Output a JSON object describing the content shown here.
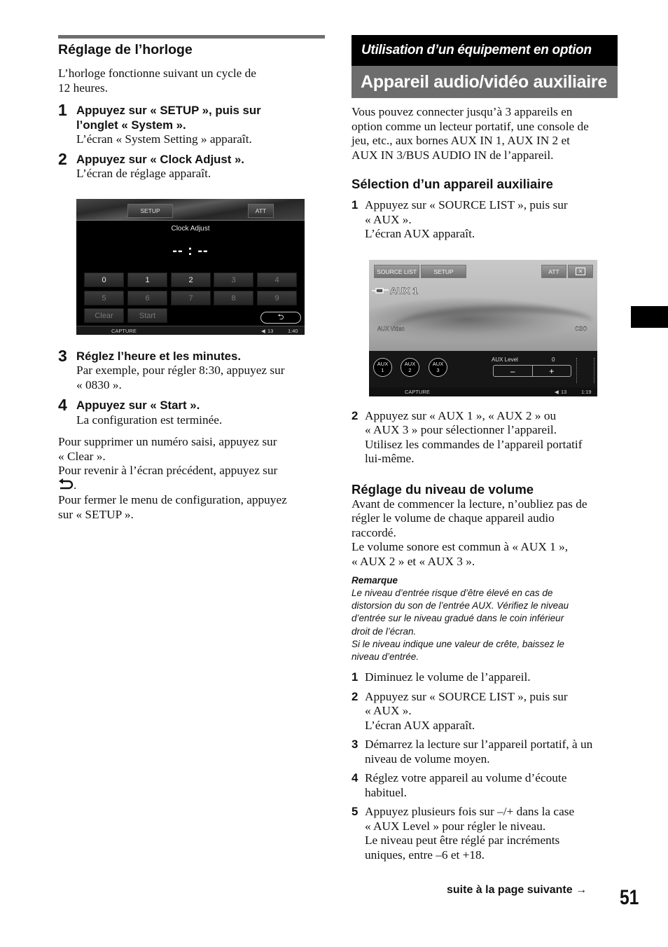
{
  "left": {
    "section_title": "Réglage de l’horloge",
    "intro": [
      "L’horloge fonctionne suivant un cycle de",
      "12 heures."
    ],
    "steps": [
      {
        "num": "1",
        "title": [
          "Appuyez sur « SETUP », puis sur",
          "l’onglet « System »."
        ],
        "body": [
          "L’écran « System Setting » apparaît."
        ]
      },
      {
        "num": "2",
        "title": [
          "Appuyez sur « Clock Adjust »."
        ],
        "body": [
          "L’écran de réglage apparaît."
        ]
      },
      {
        "num": "3",
        "title": [
          "Réglez l’heure et les minutes."
        ],
        "body": [
          "Par exemple, pour régler 8:30, appuyez sur",
          "« 0830 »."
        ]
      },
      {
        "num": "4",
        "title": [
          "Appuyez sur « Start »."
        ],
        "body": [
          "La configuration est terminée."
        ]
      }
    ],
    "tips": [
      "Pour supprimer un numéro saisi, appuyez sur",
      "« Clear ».",
      "Pour revenir à l’écran précédent, appuyez sur",
      ".",
      "Pour fermer le menu de configuration, appuyez",
      "sur « SETUP »."
    ],
    "back_icon": "return-arrow-icon"
  },
  "clock_screen": {
    "setup_btn": "SETUP",
    "att_btn": "ATT",
    "title": "Clock Adjust",
    "time_display": "-- : --",
    "keys": [
      "0",
      "1",
      "2",
      "3",
      "4",
      "5",
      "6",
      "7",
      "8",
      "9"
    ],
    "clear": "Clear",
    "start": "Start",
    "back_glyph": "⮌",
    "status_capture": "CAPTURE",
    "status_volume": "13",
    "status_time": "1:40"
  },
  "right": {
    "section_band": "Utilisation d’un équipement en option",
    "title_band": "Appareil audio/vidéo auxiliaire",
    "intro": [
      "Vous pouvez connecter jusqu’à 3 appareils en",
      "option comme un lecteur portatif, une console de",
      "jeu, etc., aux bornes AUX IN 1, AUX IN 2 et",
      "AUX IN 3/BUS AUDIO IN de l’appareil."
    ],
    "sub1_title": "Sélection d’un appareil auxiliaire",
    "sub1_steps": [
      {
        "num": "1",
        "lines": [
          "Appuyez sur « SOURCE LIST », puis sur",
          "« AUX ».",
          "L’écran AUX apparaît."
        ]
      },
      {
        "num": "2",
        "lines": [
          "Appuyez sur « AUX 1 », « AUX 2 » ou",
          "« AUX 3 » pour sélectionner l’appareil.",
          "Utilisez les commandes de l’appareil portatif",
          "lui-même."
        ]
      }
    ],
    "sub2_title": "Réglage du niveau de volume",
    "sub2_intro": [
      "Avant de commencer la lecture, n’oubliez pas de",
      "régler le volume de chaque appareil audio",
      "raccordé.",
      "Le volume sonore est commun à « AUX 1 »,",
      "« AUX 2 » et « AUX 3 »."
    ],
    "note_title": "Remarque",
    "note_lines": [
      "Le niveau d’entrée risque d’être élevé en cas de",
      "distorsion du son de l’entrée AUX. Vérifiez le niveau",
      "d’entrée sur le niveau gradué dans le coin inférieur",
      "droit de l’écran.",
      "Si le niveau indique une valeur de crête, baissez le",
      "niveau d’entrée."
    ],
    "sub2_steps": [
      {
        "num": "1",
        "lines": [
          "Diminuez le volume de l’appareil."
        ]
      },
      {
        "num": "2",
        "lines": [
          "Appuyez sur « SOURCE LIST », puis sur",
          "« AUX ».",
          "L’écran AUX apparaît."
        ]
      },
      {
        "num": "3",
        "lines": [
          "Démarrez la lecture sur l’appareil portatif, à un",
          "niveau de volume moyen."
        ]
      },
      {
        "num": "4",
        "lines": [
          "Réglez votre appareil au volume d’écoute",
          "habituel."
        ]
      },
      {
        "num": "5",
        "lines": [
          "Appuyez plusieurs fois sur –/+ dans la case",
          "« AUX Level » pour régler le niveau.",
          "Le niveau peut être réglé par incréments",
          "uniques, entre –6 et +18."
        ]
      }
    ]
  },
  "aux_screen": {
    "source_list_btn": "SOURCE LIST",
    "setup_btn": "SETUP",
    "att_btn": "ATT",
    "close_glyph": "✕",
    "source_label": "AUX 1",
    "video_label": "AUX Video",
    "cso_label": "CSO",
    "aux_buttons": [
      {
        "top": "AUX",
        "num": "1"
      },
      {
        "top": "AUX",
        "num": "2"
      },
      {
        "top": "AUX",
        "num": "3"
      }
    ],
    "level_label": "AUX Level",
    "level_value": "0",
    "minus": "–",
    "plus": "+",
    "status_capture": "CAPTURE",
    "status_volume": "13",
    "status_time": "1:19"
  },
  "footer": {
    "continued": "suite à la page suivante →",
    "page_number": "51"
  }
}
